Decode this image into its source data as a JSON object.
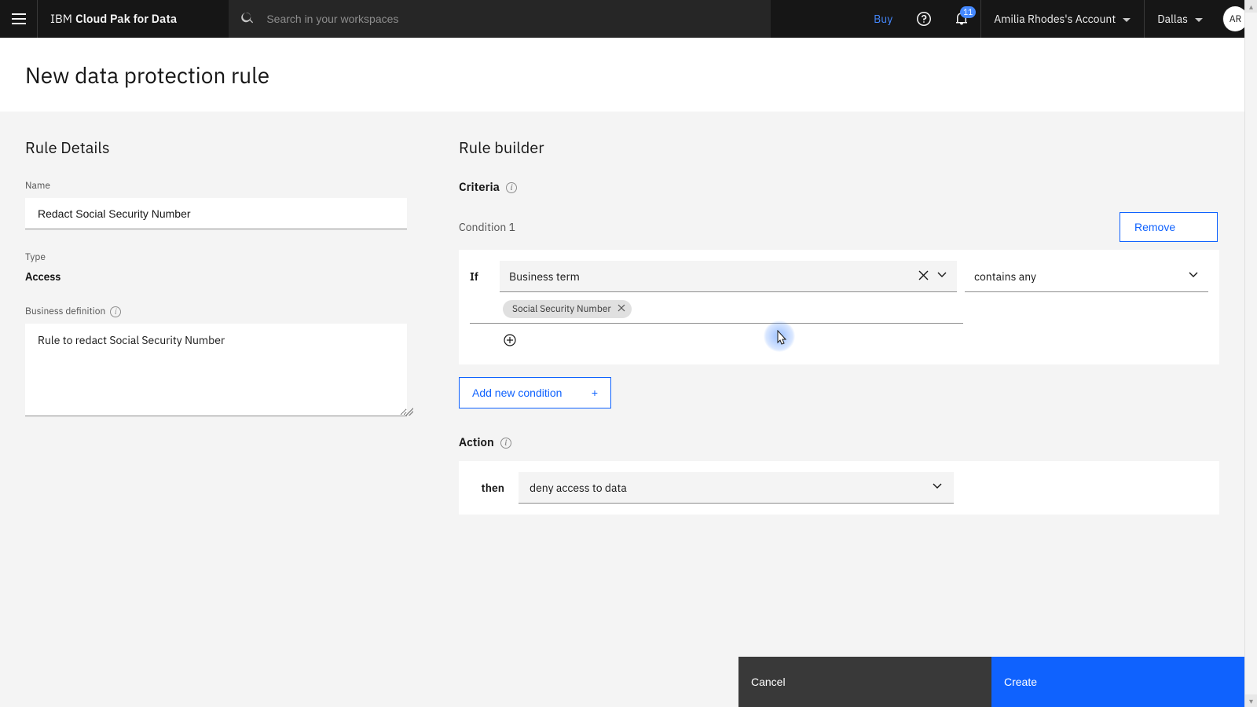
{
  "header": {
    "brand_prefix": "IBM",
    "brand_product": "Cloud Pak for Data",
    "search_placeholder": "Search in your workspaces",
    "buy_label": "Buy",
    "notification_count": "11",
    "account_label": "Amilia Rhodes's Account",
    "region_label": "Dallas",
    "avatar_initials": "AR"
  },
  "page": {
    "title": "New data protection rule"
  },
  "rule_details": {
    "heading": "Rule Details",
    "name_label": "Name",
    "name_value": "Redact Social Security Number",
    "type_label": "Type",
    "type_value": "Access",
    "definition_label": "Business definition",
    "definition_value": "Rule to redact Social Security Number"
  },
  "rule_builder": {
    "heading": "Rule builder",
    "criteria_label": "Criteria",
    "condition_label": "Condition 1",
    "remove_label": "Remove",
    "if_label": "If",
    "criteria_type_value": "Business term",
    "operator_value": "contains any",
    "tag_value": "Social Security Number",
    "add_condition_label": "Add new condition",
    "action_label": "Action",
    "then_label": "then",
    "action_value": "deny access to data"
  },
  "footer": {
    "cancel_label": "Cancel",
    "create_label": "Create"
  }
}
